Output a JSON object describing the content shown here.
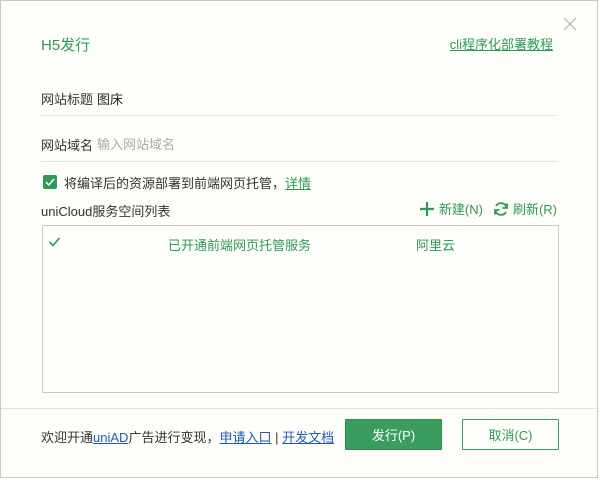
{
  "dialog": {
    "title": "H5发行",
    "cli_link": "cli程序化部署教程"
  },
  "fields": {
    "site_title_label": "网站标题",
    "site_title_value": "图床",
    "domain_label": "网站域名",
    "domain_placeholder": "输入网站域名",
    "domain_value": ""
  },
  "deploy_option": {
    "checked": true,
    "text": "将编译后的资源部署到前端网页托管，",
    "detail_link": "详情"
  },
  "space_list": {
    "title": "uniCloud服务空间列表",
    "new_label": "新建(N)",
    "refresh_label": "刷新(R)",
    "rows": [
      {
        "selected": true,
        "name": "",
        "status": "已开通前端网页托管服务",
        "provider": "阿里云"
      }
    ]
  },
  "footer": {
    "promo_prefix": "欢迎开通",
    "promo_brand": "uniAD",
    "promo_middle": "广告进行变现，",
    "apply_link": "申请入口",
    "divider": "|",
    "docs_link": "开发文档",
    "publish_button": "发行(P)",
    "cancel_button": "取消(C)"
  },
  "colors": {
    "accent": "#2f9a55",
    "link_blue": "#1f5bb5",
    "background": "#fdfdf9",
    "border": "#c9c9c3"
  },
  "icons": {
    "close": "close-icon",
    "check": "check-icon",
    "plus": "plus-icon",
    "refresh": "refresh-icon"
  }
}
